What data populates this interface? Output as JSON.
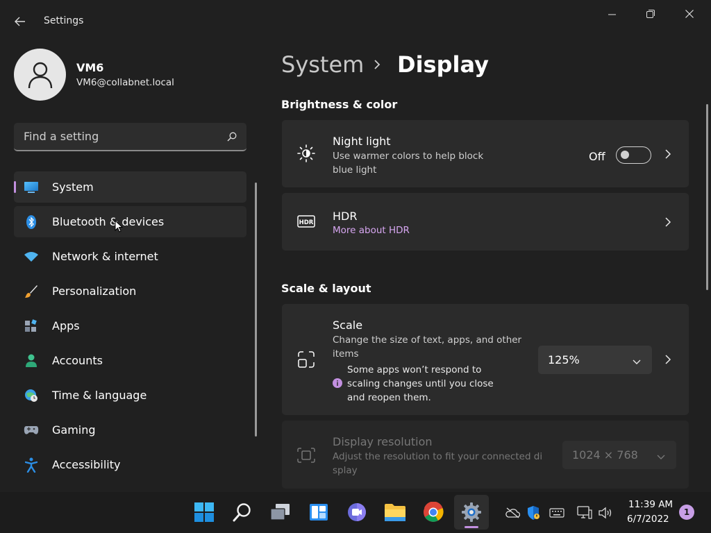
{
  "window": {
    "title": "Settings"
  },
  "user": {
    "name": "VM6",
    "email": "VM6@collabnet.local"
  },
  "search": {
    "placeholder": "Find a setting"
  },
  "sidebar": {
    "items": [
      {
        "label": "System",
        "icon": "monitor-icon"
      },
      {
        "label": "Bluetooth & devices",
        "icon": "bluetooth-icon"
      },
      {
        "label": "Network & internet",
        "icon": "wifi-icon"
      },
      {
        "label": "Personalization",
        "icon": "brush-icon"
      },
      {
        "label": "Apps",
        "icon": "apps-icon"
      },
      {
        "label": "Accounts",
        "icon": "person-icon"
      },
      {
        "label": "Time & language",
        "icon": "globe-clock-icon"
      },
      {
        "label": "Gaming",
        "icon": "gamepad-icon"
      },
      {
        "label": "Accessibility",
        "icon": "accessibility-icon"
      }
    ]
  },
  "breadcrumb": {
    "parent": "System",
    "current": "Display"
  },
  "sections": {
    "brightness_title": "Brightness & color",
    "scale_title": "Scale & layout"
  },
  "night_light": {
    "title": "Night light",
    "subtitle_line1": "Use warmer colors to help block",
    "subtitle_line2": "blue light",
    "state": "Off"
  },
  "hdr": {
    "title": "HDR",
    "link": "More about HDR"
  },
  "scale": {
    "title": "Scale",
    "subtitle_line1": "Change the size of text, apps, and other",
    "subtitle_line2": "items",
    "warning_line1": "Some apps won’t respond to",
    "warning_line2": "scaling changes until you close",
    "warning_line3": "and reopen them.",
    "value": "125%"
  },
  "resolution": {
    "title": "Display resolution",
    "subtitle_line1": "Adjust the resolution to fit your connected di",
    "subtitle_line2": "splay",
    "value": "1024 × 768"
  },
  "taskbar": {
    "time": "11:39 AM",
    "date": "6/7/2022",
    "notifications": "1"
  },
  "colors": {
    "accent": "#c390e0",
    "background": "#202020",
    "card": "#2b2b2b"
  }
}
